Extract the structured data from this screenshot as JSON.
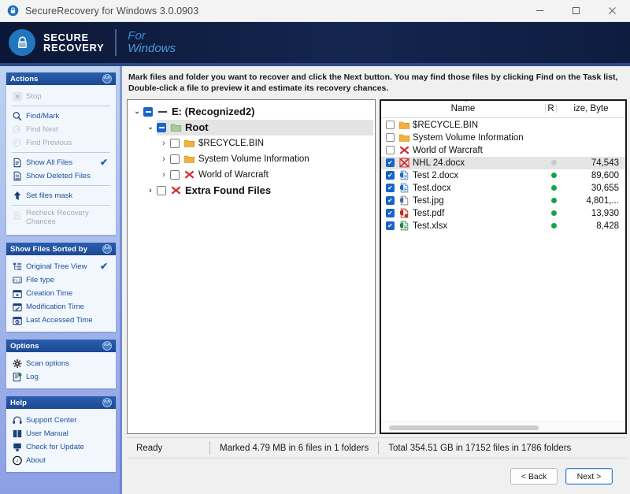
{
  "titlebar": {
    "title": "SecureRecovery for Windows 3.0.0903",
    "app_icon": "lock-shield-icon",
    "minimize": "–",
    "maximize": "□",
    "close": "✕"
  },
  "brand": {
    "line1": "SECURE",
    "line2": "RECOVERY",
    "for": "For",
    "windows": "Windows",
    "accent": "#2176bd",
    "band_bg": "#0d1b3e"
  },
  "sidebar": {
    "panels": [
      {
        "title": "Actions",
        "groups": [
          [
            {
              "label": "Stop",
              "icon": "stop-icon",
              "disabled": true,
              "checked": false
            }
          ],
          [
            {
              "label": "Find/Mark",
              "icon": "magnifier-icon",
              "disabled": false,
              "checked": false
            },
            {
              "label": "Find Next",
              "icon": "find-next-icon",
              "disabled": true,
              "checked": false
            },
            {
              "label": "Find Previous",
              "icon": "find-previous-icon",
              "disabled": true,
              "checked": false
            }
          ],
          [
            {
              "label": "Show All Files",
              "icon": "document-icon",
              "disabled": false,
              "checked": true
            },
            {
              "label": "Show Deleted Files",
              "icon": "deleted-document-icon",
              "disabled": false,
              "checked": false
            }
          ],
          [
            {
              "label": "Set files mask",
              "icon": "funnel-icon",
              "disabled": false,
              "checked": false
            }
          ],
          [
            {
              "label": "Recheck Recovery Chances",
              "icon": "recheck-icon",
              "disabled": true,
              "checked": false,
              "two_line": true
            }
          ]
        ]
      },
      {
        "title": "Show Files Sorted by",
        "groups": [
          [
            {
              "label": "Original Tree View",
              "icon": "tree-view-icon",
              "disabled": false,
              "checked": true
            },
            {
              "label": "File type",
              "icon": "file-type-icon",
              "disabled": false,
              "checked": false
            },
            {
              "label": "Creation Time",
              "icon": "calendar-create-icon",
              "disabled": false,
              "checked": false
            },
            {
              "label": "Modification Time",
              "icon": "calendar-modify-icon",
              "disabled": false,
              "checked": false
            },
            {
              "label": "Last Accessed Time",
              "icon": "calendar-access-icon",
              "disabled": false,
              "checked": false
            }
          ]
        ]
      },
      {
        "title": "Options",
        "groups": [
          [
            {
              "label": "Scan options",
              "icon": "gear-icon",
              "disabled": false,
              "checked": false
            },
            {
              "label": "Log",
              "icon": "log-icon",
              "disabled": false,
              "checked": false
            }
          ]
        ]
      },
      {
        "title": "Help",
        "groups": [
          [
            {
              "label": "Support Center",
              "icon": "headset-icon",
              "disabled": false,
              "checked": false
            },
            {
              "label": "User Manual",
              "icon": "book-icon",
              "disabled": false,
              "checked": false
            },
            {
              "label": "Check for Update",
              "icon": "download-icon",
              "disabled": false,
              "checked": false
            },
            {
              "label": "About",
              "icon": "info-icon",
              "disabled": false,
              "checked": false
            }
          ]
        ]
      }
    ]
  },
  "main": {
    "instructions": "Mark files and folder you want to recover and click the Next button. You may find those files by clicking Find on the Task list, Double-click a file to preview it and estimate its recovery chances.",
    "tree": [
      {
        "label": "E: (Recognized2)",
        "indent": 0,
        "chevron": "⌄",
        "checkbox": "partial",
        "icon": "drive-icon",
        "bold": true,
        "selected": false
      },
      {
        "label": "Root",
        "indent": 1,
        "chevron": "⌄",
        "checkbox": "partial",
        "icon": "folder-open-icon",
        "bold": true,
        "selected": true
      },
      {
        "label": "$RECYCLE.BIN",
        "indent": 2,
        "chevron": "›",
        "checkbox": "empty",
        "icon": "folder-icon",
        "bold": false,
        "selected": false
      },
      {
        "label": "System Volume Information",
        "indent": 2,
        "chevron": "›",
        "checkbox": "empty",
        "icon": "folder-icon",
        "bold": false,
        "selected": false
      },
      {
        "label": "World of Warcraft",
        "indent": 2,
        "chevron": "›",
        "checkbox": "empty",
        "icon": "deleted-folder-icon",
        "bold": false,
        "selected": false
      },
      {
        "label": "Extra Found Files",
        "indent": 1,
        "chevron": "›",
        "checkbox": "empty",
        "icon": "deleted-folder-icon",
        "bold": true,
        "selected": false
      }
    ],
    "list": {
      "columns": {
        "name": "Name",
        "recovery": "R",
        "size": "ize, Byte"
      },
      "sort_indicator": "⌃",
      "rows": [
        {
          "name": "$RECYCLE.BIN",
          "icon": "folder-icon",
          "checked": false,
          "chance": "none",
          "size": "",
          "selected": false
        },
        {
          "name": "System Volume Information",
          "icon": "folder-icon",
          "checked": false,
          "chance": "none",
          "size": "",
          "selected": false
        },
        {
          "name": "World of Warcraft",
          "icon": "deleted-folder-icon",
          "checked": false,
          "chance": "none",
          "size": "",
          "selected": false
        },
        {
          "name": "NHL 24.docx",
          "icon": "deleted-file-icon",
          "checked": true,
          "chance": "gray",
          "size": "74,543",
          "selected": true
        },
        {
          "name": "Test 2.docx",
          "icon": "word-file-icon",
          "checked": true,
          "chance": "good",
          "size": "89,600",
          "selected": false
        },
        {
          "name": "Test.docx",
          "icon": "word-file-icon",
          "checked": true,
          "chance": "good",
          "size": "30,655",
          "selected": false
        },
        {
          "name": "Test.jpg",
          "icon": "image-file-icon",
          "checked": true,
          "chance": "good",
          "size": "4,801,...",
          "selected": false
        },
        {
          "name": "Test.pdf",
          "icon": "pdf-file-icon",
          "checked": true,
          "chance": "good",
          "size": "13,930",
          "selected": false
        },
        {
          "name": "Test.xlsx",
          "icon": "excel-file-icon",
          "checked": true,
          "chance": "good",
          "size": "8,428",
          "selected": false
        }
      ]
    }
  },
  "status": {
    "ready": "Ready",
    "marked": "Marked 4.79 MB in 6 files in 1 folders",
    "total": "Total 354.51 GB in 17152 files in 1786 folders"
  },
  "footer": {
    "back": "< Back",
    "next": "Next >"
  }
}
